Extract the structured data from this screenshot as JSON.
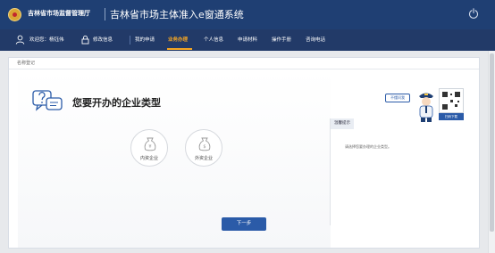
{
  "header": {
    "org": "吉林省市场监督管理厅",
    "app_title": "吉林省市场主体准入e窗通系统",
    "icons": [
      "emblem-icon",
      "power-icon"
    ]
  },
  "nav": {
    "welcome": "欢迎您：杨钰伟",
    "change_info": "修改信息",
    "items": [
      "我的申请",
      "业务办理",
      "个人信息",
      "申请材料",
      "操作手册",
      "咨询电话"
    ],
    "active": "业务办理",
    "icons": [
      "user-icon",
      "lock-icon"
    ],
    "accent": "#f5a623"
  },
  "breadcrumb": "名称登记",
  "main": {
    "heading": "您要开办的企业类型",
    "options": [
      "内资企业",
      "外资企业"
    ],
    "next": "下一步"
  },
  "tip": {
    "title": "温馨提示",
    "text": "请选择您要办理的企业类型。"
  },
  "assistant": {
    "bubble": "不懂问我",
    "qr_label": "扫码下载"
  },
  "colors": {
    "header_bg": "#1f3f73",
    "nav_bg": "#223a68",
    "primary": "#2b5ba8"
  }
}
